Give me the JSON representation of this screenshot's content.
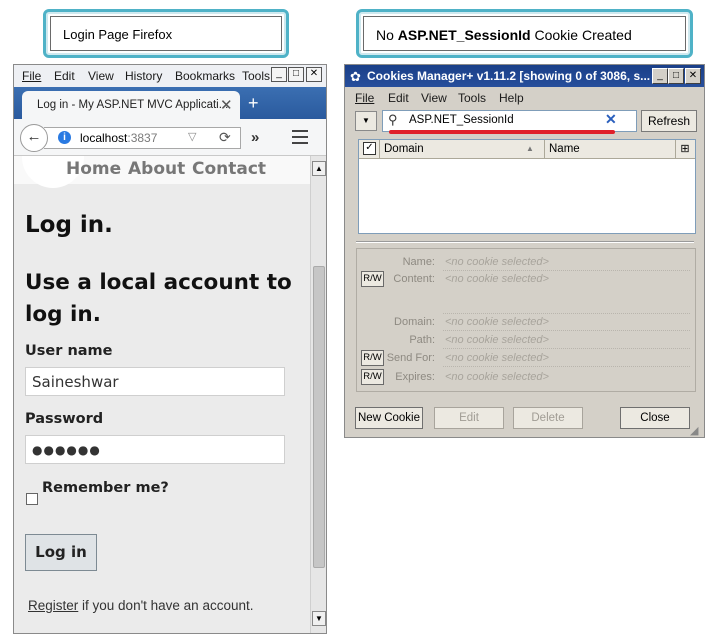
{
  "callouts": {
    "left": "Login Page Firefox",
    "right_prefix": "No ",
    "right_bold": "ASP.NET_SessionId",
    "right_suffix": " Cookie Created"
  },
  "firefox": {
    "menu": [
      "File",
      "Edit",
      "View",
      "History",
      "Bookmarks",
      "Tools"
    ],
    "tab_title": "Log in - My ASP.NET MVC Applicati...",
    "url_host": "localhost",
    "url_port": ":3837",
    "nav_links": [
      "Home",
      "About",
      "Contact"
    ],
    "heading": "Log in.",
    "subheading": "Use a local account to log in.",
    "username_label": "User name",
    "username_value": "Saineshwar",
    "password_label": "Password",
    "password_value": "●●●●●●",
    "remember_label": "Remember me?",
    "login_button": "Log in",
    "register_link": "Register",
    "register_suffix": " if you don't have an account."
  },
  "cookies_manager": {
    "title": "Cookies Manager+ v1.11.2 [showing 0 of 3086, s...",
    "menu": [
      "File",
      "Edit",
      "View",
      "Tools",
      "Help"
    ],
    "search_value": "ASP.NET_SessionId",
    "refresh": "Refresh",
    "columns": [
      "Domain",
      "Name"
    ],
    "details": [
      {
        "label": "Name:",
        "value": "<no cookie selected>",
        "rw": false
      },
      {
        "label": "Content:",
        "value": "<no cookie selected>",
        "rw": true
      },
      {
        "label": "Domain:",
        "value": "<no cookie selected>",
        "rw": false
      },
      {
        "label": "Path:",
        "value": "<no cookie selected>",
        "rw": false
      },
      {
        "label": "Send For:",
        "value": "<no cookie selected>",
        "rw": true
      },
      {
        "label": "Expires:",
        "value": "<no cookie selected>",
        "rw": true
      }
    ],
    "rw_label": "R/W",
    "buttons": {
      "new": "New Cookie",
      "edit": "Edit",
      "delete": "Delete",
      "close": "Close"
    }
  },
  "colors": {
    "callout_border": "#4fb2c7",
    "search_underline": "#e0202a",
    "ff_tabstrip": "#2a5a9e",
    "cm_titlebar": "#1a3f88"
  }
}
